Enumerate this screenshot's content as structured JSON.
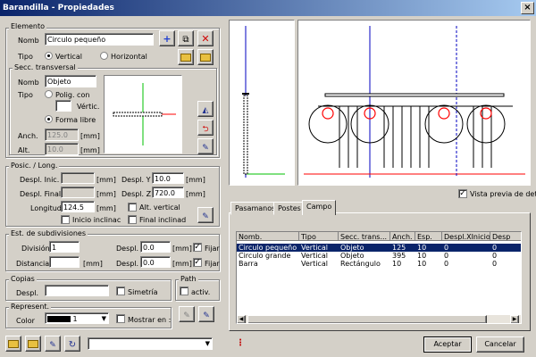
{
  "title": "Barandilla - Propiedades",
  "elemento": {
    "legend": "Elemento",
    "nomb_label": "Nomb",
    "nomb_value": "Circulo pequeño",
    "tipo_label": "Tipo",
    "tipo_vertical": "Vertical",
    "tipo_horizontal": "Horizontal"
  },
  "secc": {
    "legend": "Secc. transversal",
    "nomb_label": "Nomb",
    "nomb_value": "Objeto",
    "tipo_label": "Tipo",
    "polig_label": "Polig. con",
    "vertic_label": "Vértic.",
    "forma_label": "Forma libre",
    "anch_label": "Anch.",
    "anch_value": "125.0",
    "alt_label": "Alt.",
    "alt_value": "10.0",
    "unit": "[mm]"
  },
  "posic": {
    "legend": "Posic. / Long.",
    "despl_inic_label": "Despl. Inic.",
    "despl_final_label": "Despl. Final",
    "longitud_label": "Longitud",
    "longitud_value": "124.5",
    "despl_y_label": "Despl. Y",
    "despl_y_value": "10.0",
    "despl_z_label": "Despl. Z",
    "despl_z_value": "720.0",
    "alt_vertical": "Alt. vertical",
    "inicio_inclinac": "Inicio inclinac",
    "final_inclinad": "Final inclinad",
    "unit": "[mm]"
  },
  "subdiv": {
    "legend": "Est. de subdivisiones",
    "division_label": "División",
    "division_value": "1",
    "distancia_label": "Distancia",
    "despl_label": "Despl.",
    "despl1_value": "0.0",
    "despl2_value": "0.0",
    "fijar_label": "Fijar",
    "unit": "[mm]"
  },
  "copias": {
    "legend": "Copias",
    "despl_label": "Despl.",
    "simetria": "Simetría"
  },
  "path": {
    "legend": "Path",
    "activ": "activ."
  },
  "represent": {
    "legend": "Represent.",
    "color_label": "Color",
    "color_value": "1",
    "mostrar": "Mostrar en :"
  },
  "vista_previa": "Vista previa de deta",
  "tabs": [
    "Pasamanos",
    "Postes",
    "Campo"
  ],
  "table": {
    "headers": [
      "Nomb.",
      "Tipo",
      "Secc. trans...",
      "Anch.",
      "Esp.",
      "Despl.XInicio",
      "Desp"
    ],
    "rows": [
      [
        "Circulo pequeño",
        "Vertical",
        "Objeto",
        "125",
        "10",
        "0",
        "0"
      ],
      [
        "Circulo grande",
        "Vertical",
        "Objeto",
        "395",
        "10",
        "0",
        "0"
      ],
      [
        "Barra",
        "Vertical",
        "Rectángulo",
        "10",
        "10",
        "0",
        "0"
      ]
    ]
  },
  "buttons": {
    "aceptar": "Aceptar",
    "cancelar": "Cancelar"
  },
  "colors": {
    "title_start": "#0a246a",
    "title_end": "#a6caf0",
    "select": "#0a246a",
    "axis_blue": "#0000c0",
    "axis_green": "#00c000",
    "axis_red": "#ff0000"
  }
}
